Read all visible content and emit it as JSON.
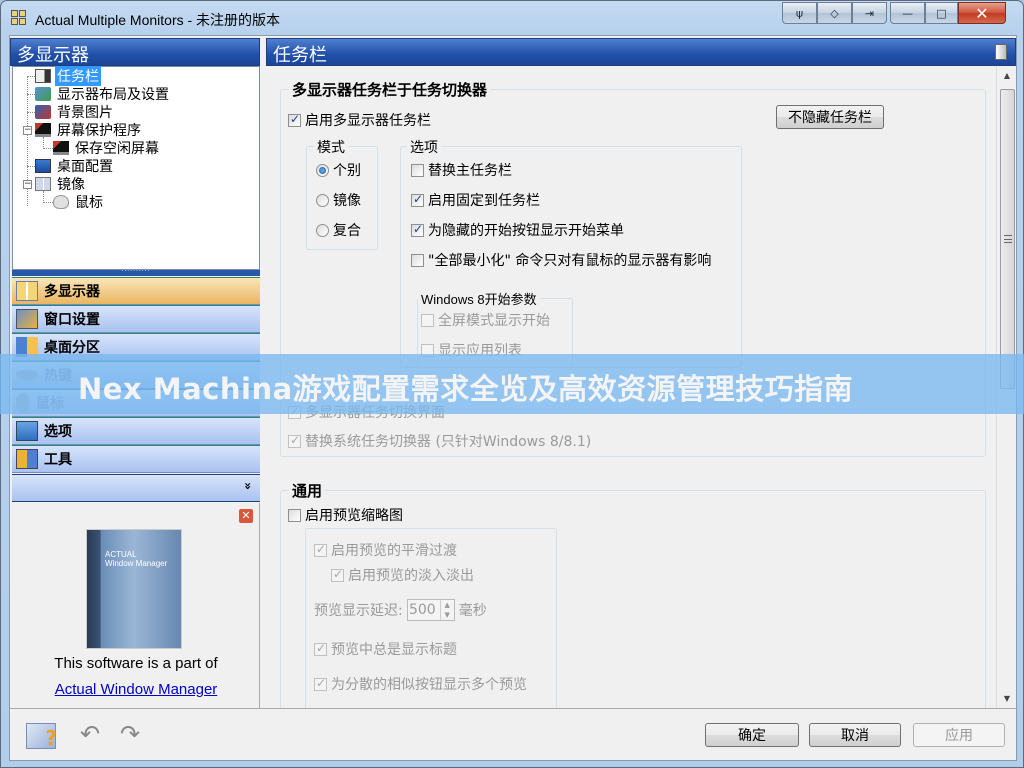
{
  "window": {
    "title": "Actual Multiple Monitors - 未注册的版本",
    "title_buttons": [
      "wrench-icon",
      "move-icon",
      "enter-icon"
    ],
    "controls": {
      "minimize": "—",
      "maximize": "□",
      "close": "✕"
    }
  },
  "left": {
    "header": "多显示器",
    "tree": [
      {
        "label": "任务栏",
        "selected": true
      },
      {
        "label": "显示器布局及设置"
      },
      {
        "label": "背景图片"
      },
      {
        "label": "屏幕保护程序",
        "expanded": true
      },
      {
        "label": "保存空闲屏幕"
      },
      {
        "label": "桌面配置"
      },
      {
        "label": "镜像",
        "expanded": true
      },
      {
        "label": "鼠标"
      }
    ],
    "nav": [
      {
        "label": "多显示器",
        "active": true
      },
      {
        "label": "窗口设置"
      },
      {
        "label": "桌面分区"
      },
      {
        "label": "热键",
        "disabled": true
      },
      {
        "label": "鼠标",
        "disabled": true
      },
      {
        "label": "选项"
      },
      {
        "label": "工具"
      }
    ],
    "nav_more": "»",
    "promo": {
      "close": "✕",
      "box_brand": "ACTUAL",
      "box_title": "Window Manager",
      "text": "This software is a part of",
      "link": "Actual Window Manager"
    }
  },
  "right": {
    "header": "任务栏",
    "group1": {
      "title": "多显示器任务栏于任务切换器",
      "enable_taskbar": {
        "label": "启用多显示器任务栏",
        "checked": true
      },
      "unhide_button": "不隐藏任务栏",
      "mode": {
        "title": "模式",
        "options": [
          {
            "label": "个别",
            "selected": true
          },
          {
            "label": "镜像",
            "selected": false
          },
          {
            "label": "复合",
            "selected": false
          }
        ]
      },
      "options": {
        "title": "选项",
        "items": [
          {
            "label": "替换主任务栏",
            "checked": false
          },
          {
            "label": "启用固定到任务栏",
            "checked": true
          },
          {
            "label": "为隐藏的开始按钮显示开始菜单",
            "checked": true
          },
          {
            "label": "\"全部最小化\" 命令只对有鼠标的显示器有影响",
            "checked": false
          }
        ],
        "win8": {
          "title": "Windows 8开始参数",
          "items": [
            {
              "label": "全屏模式显示开始",
              "checked": false
            },
            {
              "label": "显示应用列表",
              "checked": false
            }
          ]
        }
      },
      "switcher": {
        "label": "多显示器任务切换界面",
        "checked": true
      },
      "replace_switcher": {
        "label": "替换系统任务切换器 (只针对Windows 8/8.1)",
        "checked": true
      }
    },
    "group2": {
      "title": "通用",
      "enable_preview": {
        "label": "启用预览缩略图",
        "checked": false
      },
      "smooth": {
        "label": "启用预览的平滑过渡",
        "checked": true
      },
      "fade": {
        "label": "启用预览的淡入淡出",
        "checked": true
      },
      "delay_label": "预览显示延迟:",
      "delay_value": "500",
      "delay_unit": "毫秒",
      "always_title": {
        "label": "预览中总是显示标题",
        "checked": true
      },
      "multi_preview": {
        "label": "为分散的相似按钮显示多个预览",
        "checked": true
      }
    }
  },
  "footer": {
    "ok": "确定",
    "cancel": "取消",
    "apply": "应用"
  },
  "overlay_banner": "Nex Machina游戏配置需求全览及高效资源管理技巧指南"
}
